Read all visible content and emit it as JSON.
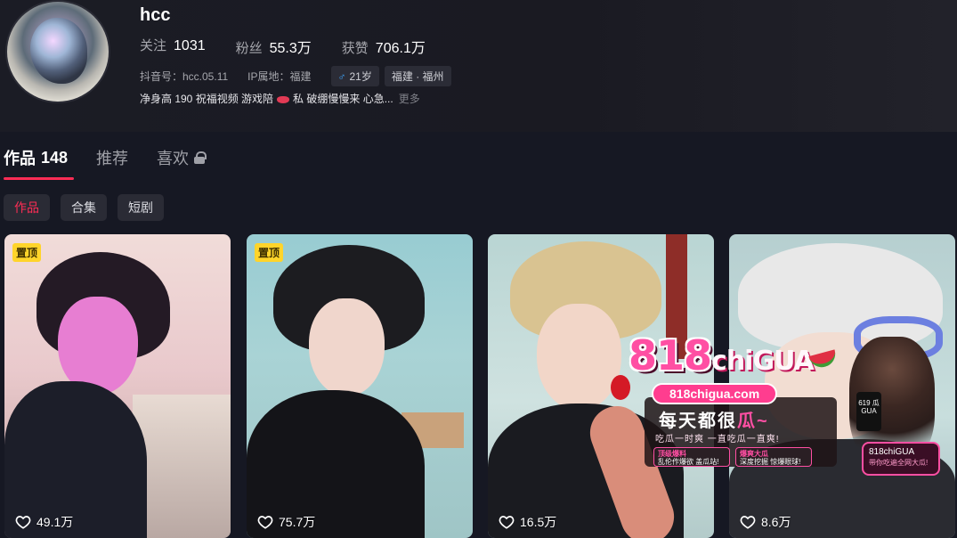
{
  "profile": {
    "username": "hcc",
    "stats": [
      {
        "label": "关注",
        "value": "1031"
      },
      {
        "label": "粉丝",
        "value": "55.3万"
      },
      {
        "label": "获赞",
        "value": "706.1万"
      }
    ],
    "douyin_id": "抖音号：hcc.05.11",
    "ip_location": "IP属地：福建",
    "age_tag": "21岁",
    "region_tag": "福建 · 福州",
    "bio_part1": "净身高 190 祝福视频 游戏陪",
    "bio_part2": "私 破绷慢慢来 心急...",
    "bio_more": "更多"
  },
  "tabs": [
    {
      "label": "作品",
      "count": "148"
    },
    {
      "label": "推荐"
    },
    {
      "label": "喜欢"
    }
  ],
  "subtabs": [
    "作品",
    "合集",
    "短剧"
  ],
  "videos": [
    {
      "pinned": "置顶",
      "likes": "49.1万"
    },
    {
      "pinned": "置顶",
      "likes": "75.7万"
    },
    {
      "likes": "16.5万"
    },
    {
      "likes": "8.6万"
    }
  ],
  "ad": {
    "logo_main": "818",
    "logo_small": "chiGUA",
    "url": "818chigua.com",
    "slogan_a": "每天都很",
    "slogan_b": "瓜~",
    "sub": "吃瓜一时爽 一直吃瓜一直爽!",
    "tag1_title": "顶级爆料",
    "tag1_sub": "乱伦作爆欲 盖瓜站!",
    "tag2_title": "爆爽大瓜",
    "tag2_sub": "深度挖掘 惊爆眼球!",
    "phone_text": "619 瓜GUA",
    "card_title": "818chiGUA",
    "card_sub": "带你吃遍全网大瓜!"
  },
  "colors": {
    "accent": "#fe2c55",
    "background": "#161823",
    "pin_badge": "#ffd42a"
  }
}
